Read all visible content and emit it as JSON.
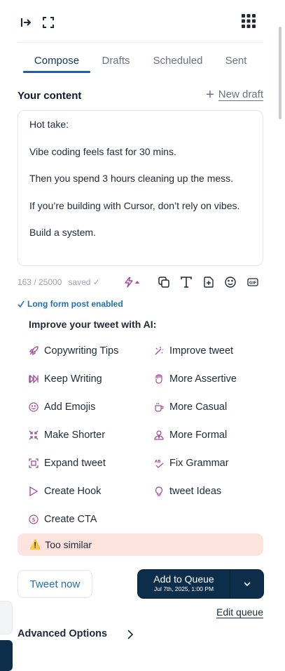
{
  "tabs": [
    {
      "label": "Compose"
    },
    {
      "label": "Drafts"
    },
    {
      "label": "Scheduled"
    },
    {
      "label": "Sent"
    }
  ],
  "content": {
    "title": "Your content",
    "new_draft": "New draft",
    "lines": [
      "Hot take:",
      "Vibe coding feels fast for 30 mins.",
      "Then you spend 3 hours cleaning up the mess.",
      "If you’re building with Cursor, don’t rely on vibes.",
      "Build a system."
    ],
    "counter": "163 / 25000",
    "saved": "saved ✓"
  },
  "longform": "Long form post enabled",
  "ai": {
    "title": "Improve your tweet with AI:",
    "left": [
      "Copywriting Tips",
      "Keep Writing",
      "Add Emojis",
      "Make Shorter",
      "Expand tweet",
      "Create Hook",
      "Create CTA"
    ],
    "right": [
      "Improve tweet",
      "More Assertive",
      "More Casual",
      "More Formal",
      "Fix Grammar",
      "tweet Ideas"
    ]
  },
  "warning": {
    "icon": "⚠️",
    "text": "Too similar"
  },
  "actions": {
    "tweet_now": "Tweet now",
    "queue_main": "Add to Queue",
    "queue_sub": "Jul 7th, 2025, 1:00 PM",
    "edit_queue": "Edit queue"
  },
  "advanced": "Advanced Options",
  "colors": {
    "accent": "#1d5fa6",
    "primary_dark": "#0d2e4b",
    "ai_icon": "#a2479b",
    "warning_bg": "#fde3dd"
  }
}
